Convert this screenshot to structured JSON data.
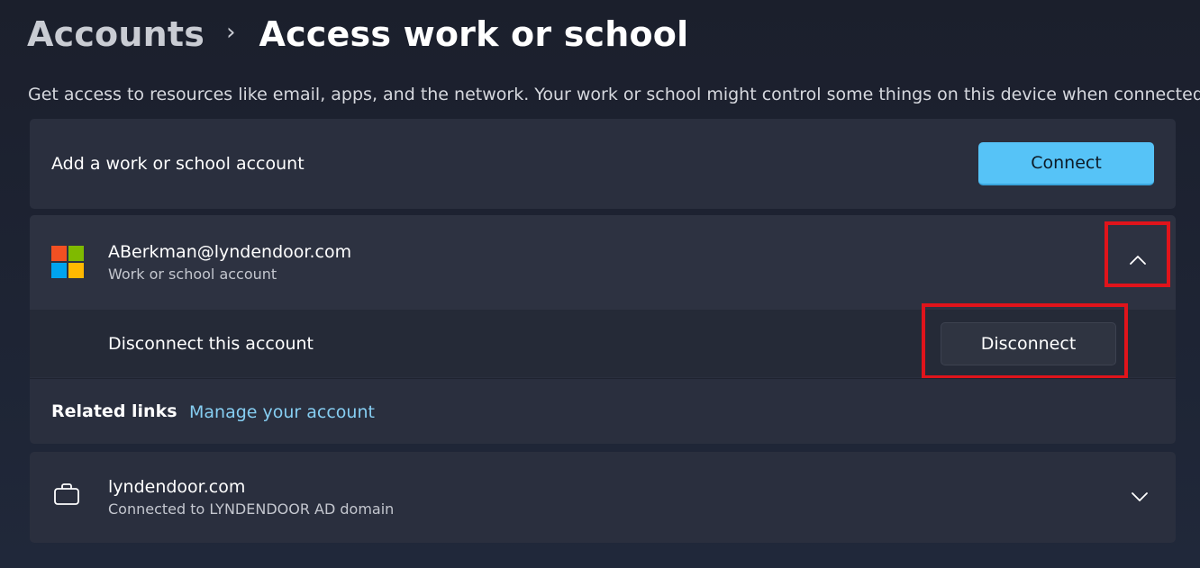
{
  "breadcrumb": {
    "parent": "Accounts",
    "separator": "›",
    "current": "Access work or school"
  },
  "description": "Get access to resources like email, apps, and the network. Your work or school might control some things on this device when connected.",
  "add_account": {
    "label": "Add a work or school account",
    "button_label": "Connect"
  },
  "account": {
    "email": "ABerkman@lyndendoor.com",
    "type": "Work or school account",
    "expanded": true,
    "disconnect_label": "Disconnect this account",
    "disconnect_button": "Disconnect"
  },
  "related": {
    "label": "Related links",
    "link": "Manage your account"
  },
  "domain": {
    "name": "lyndendoor.com",
    "status": "Connected to LYNDENDOOR AD domain"
  },
  "colors": {
    "accent": "#56c3f7",
    "link": "#86cef2",
    "highlight": "#e0141b",
    "card": "#2a2f3e"
  },
  "icons": {
    "logo": "microsoft-logo",
    "expand": "chevron-up-icon",
    "collapse": "chevron-down-icon",
    "domain": "briefcase-icon"
  }
}
